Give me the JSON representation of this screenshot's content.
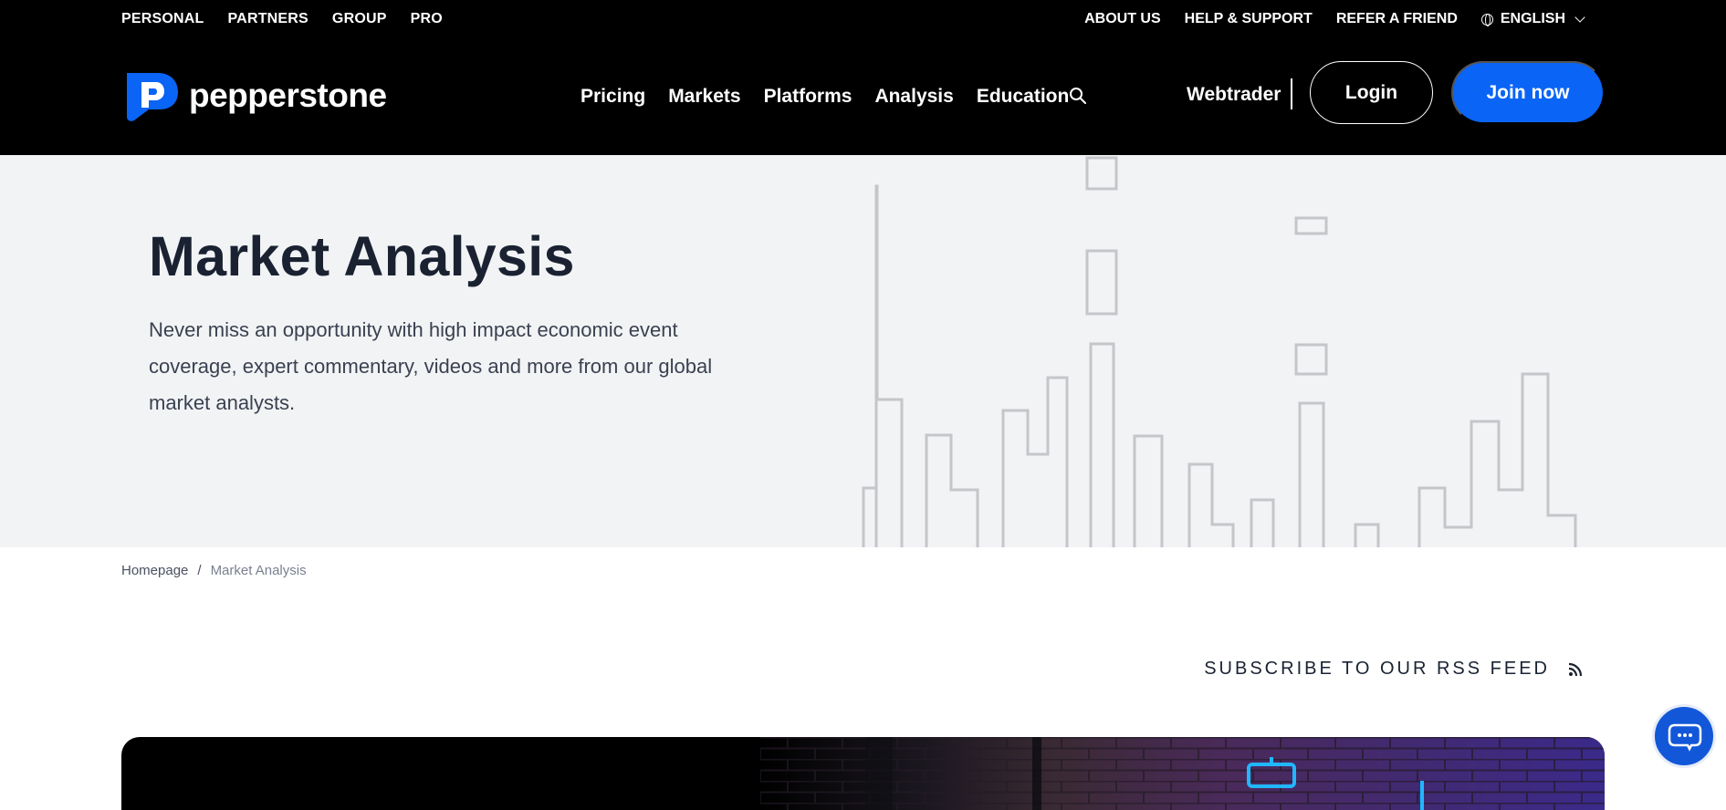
{
  "utility_nav": {
    "left": [
      "PERSONAL",
      "PARTNERS",
      "GROUP",
      "PRO"
    ],
    "right": [
      "ABOUT US",
      "HELP & SUPPORT",
      "REFER A FRIEND"
    ],
    "language": "ENGLISH"
  },
  "brand": {
    "name": "pepperstone",
    "accent": "#0a64f5"
  },
  "main_nav": [
    "Pricing",
    "Markets",
    "Platforms",
    "Analysis",
    "Education"
  ],
  "header_actions": {
    "webtrader": "Webtrader",
    "login": "Login",
    "join": "Join now"
  },
  "hero": {
    "title": "Market Analysis",
    "description": "Never miss an opportunity with high impact economic event coverage, expert commentary, videos and more from our global market analysts."
  },
  "breadcrumb": {
    "home": "Homepage",
    "separator": "/",
    "current": "Market Analysis"
  },
  "rss": {
    "label": "SUBSCRIBE TO OUR RSS FEED"
  },
  "icons": [
    "globe-icon",
    "chevron-down-icon",
    "search-icon",
    "rss-icon",
    "chat-icon"
  ]
}
